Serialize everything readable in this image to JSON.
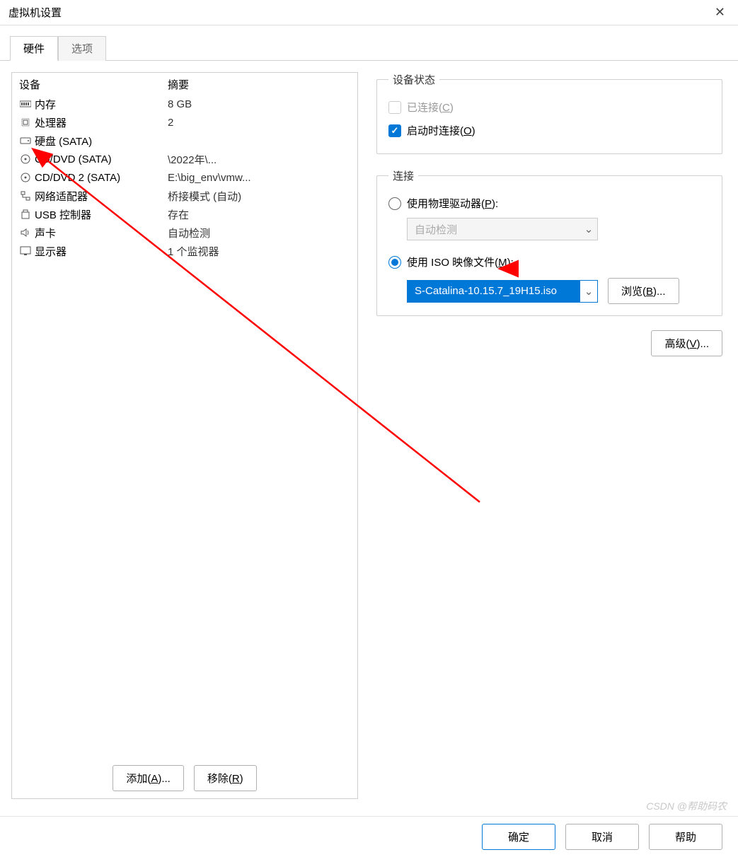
{
  "window": {
    "title": "虚拟机设置"
  },
  "tabs": {
    "hardware": "硬件",
    "options": "选项",
    "active": "hardware"
  },
  "columns": {
    "device": "设备",
    "summary": "摘要"
  },
  "devices": [
    {
      "icon": "memory",
      "name": "内存",
      "summary": "8 GB"
    },
    {
      "icon": "cpu",
      "name": "处理器",
      "summary": "2"
    },
    {
      "icon": "disk",
      "name": "硬盘 (SATA)",
      "summary": ""
    },
    {
      "icon": "cd",
      "name": "CD/DVD (SATA)",
      "summary": "\\2022年\\..."
    },
    {
      "icon": "cd",
      "name": "CD/DVD 2 (SATA)",
      "summary": "E:\\big_env\\vmw..."
    },
    {
      "icon": "net",
      "name": "网络适配器",
      "summary": "桥接模式 (自动)"
    },
    {
      "icon": "usb",
      "name": "USB 控制器",
      "summary": "存在"
    },
    {
      "icon": "sound",
      "name": "声卡",
      "summary": "自动检测"
    },
    {
      "icon": "display",
      "name": "显示器",
      "summary": "1 个监视器"
    }
  ],
  "deviceStatus": {
    "legend": "设备状态",
    "connected": {
      "label": "已连接(",
      "accel": "C",
      "suffix": ")",
      "checked": false,
      "disabled": true
    },
    "connectAtPowerOn": {
      "label": "启动时连接(",
      "accel": "O",
      "suffix": ")",
      "checked": true
    }
  },
  "connection": {
    "legend": "连接",
    "usePhysical": {
      "label": "使用物理驱动器(",
      "accel": "P",
      "suffix": "):",
      "checked": false
    },
    "physicalDrive": {
      "value": "自动检测",
      "disabled": true
    },
    "useIso": {
      "label": "使用 ISO 映像文件(",
      "accel": "M",
      "suffix": "):",
      "checked": true
    },
    "isoPath": {
      "value": "S-Catalina-10.15.7_19H15.iso"
    },
    "browse": {
      "label": "浏览(",
      "accel": "B",
      "suffix": ")..."
    }
  },
  "advanced": {
    "label": "高级(",
    "accel": "V",
    "suffix": ")..."
  },
  "leftButtons": {
    "add": {
      "label": "添加(",
      "accel": "A",
      "suffix": ")..."
    },
    "remove": {
      "label": "移除(",
      "accel": "R",
      "suffix": ")"
    }
  },
  "footer": {
    "ok": "确定",
    "cancel": "取消",
    "help": "帮助"
  },
  "watermark": "CSDN @帮助码农"
}
